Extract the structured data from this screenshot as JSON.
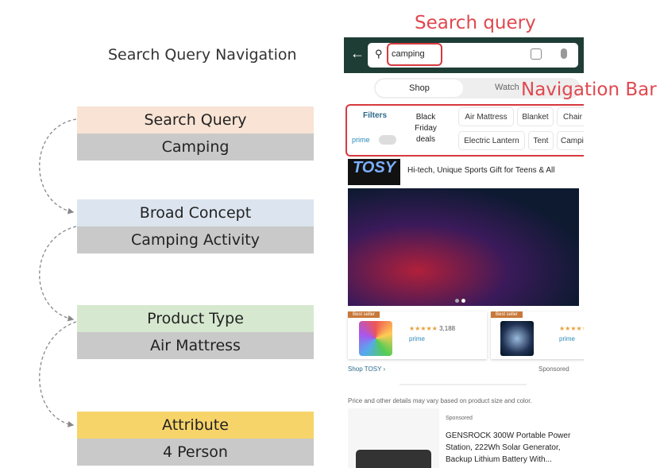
{
  "title": "Search Query Navigation",
  "annotations": {
    "search_query": "Search query",
    "navigation_bar": "Navigation Bar"
  },
  "levels": [
    {
      "label": "Search Query",
      "value": "Camping",
      "color": "#f8e3d4"
    },
    {
      "label": "Broad Concept",
      "value": "Camping Activity",
      "color": "#dce5ef"
    },
    {
      "label": "Product Type",
      "value": "Air Mattress",
      "color": "#d6e8cf"
    },
    {
      "label": "Attribute",
      "value": "4 Person",
      "color": "#f7d46a"
    }
  ],
  "phone": {
    "search_value": "camping",
    "tabs": [
      "Shop",
      "Watch"
    ],
    "filters": "Filters",
    "prime": "prime",
    "black_friday": "Black Friday deals",
    "chips_row1": [
      "Air Mattress",
      "Blanket",
      "Chair"
    ],
    "chips_row2": [
      "Electric Lantern",
      "Tent",
      "Campi"
    ],
    "brand": "TOSY",
    "brand_tagline": "Hi-tech, Unique Sports Gift for Teens & All",
    "cards": [
      {
        "badge": "Best seller",
        "rating_count": "3,188",
        "prime": "prime"
      },
      {
        "badge": "Best seller",
        "prime": "prime"
      }
    ],
    "shop_link": "Shop TOSY ›",
    "sponsored": "Sponsored",
    "disclaimer": "Price and other details may vary based on product size and color.",
    "product_sponsored": "Sponsored",
    "product_title": "GENSROCK 300W Portable Power Station, 222Wh Solar Generator, Backup Lithium Battery With..."
  }
}
